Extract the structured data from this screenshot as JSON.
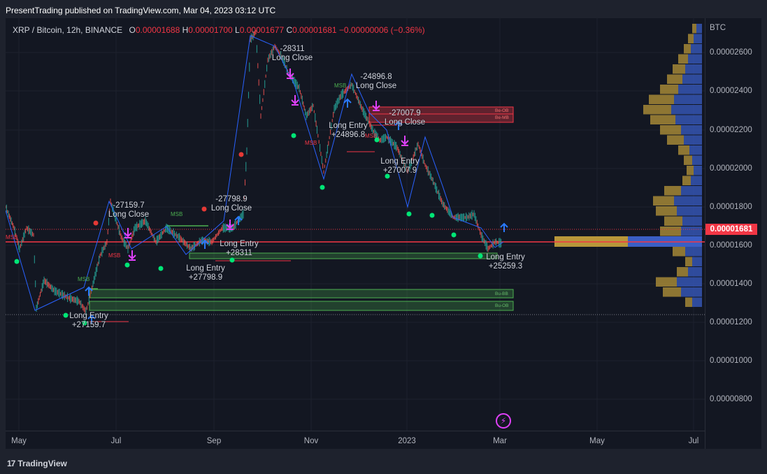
{
  "header": {
    "publisher_text": "PresentTrading published on TradingView.com, Mar 04, 2023 03:12 UTC"
  },
  "legend": {
    "symbol": "XRP / Bitcoin, 12h, BINANCE",
    "open_label": "O",
    "open": "0.00001688",
    "high_label": "H",
    "high": "0.00001700",
    "low_label": "L",
    "low": "0.00001677",
    "close_label": "C",
    "close": "0.00001681",
    "change": "−0.00000006 (−0.36%)"
  },
  "price_axis": {
    "currency": "BTC",
    "labels": [
      "0.00002600",
      "0.00002400",
      "0.00002200",
      "0.00002000",
      "0.00001800",
      "0.00001600",
      "0.00001400",
      "0.00001200",
      "0.00001000",
      "0.00000800"
    ],
    "current_price": "0.00001681"
  },
  "time_axis": {
    "labels": [
      "May",
      "Jul",
      "Sep",
      "Nov",
      "2023",
      "Mar",
      "May",
      "Jul"
    ]
  },
  "annotations": [
    {
      "line1": "-28311",
      "line2": "Long Close"
    },
    {
      "line1": "-24896.8",
      "line2": "Long Close"
    },
    {
      "line1": "-27007.9",
      "line2": "Long Close"
    },
    {
      "line1": "-27159.7",
      "line2": "Long Close"
    },
    {
      "line1": "-27798.9",
      "line2": "Long Close"
    },
    {
      "line1": "Long Entry",
      "line2": "+24896.8"
    },
    {
      "line1": "Long Entry",
      "line2": "+27007.9"
    },
    {
      "line1": "Long Entry",
      "line2": "+28311"
    },
    {
      "line1": "Long Entry",
      "line2": "+27798.9"
    },
    {
      "line1": "Long Entry",
      "line2": "+25259.3"
    },
    {
      "line1": "Long Entry",
      "line2": "+27159.7"
    }
  ],
  "labels": {
    "msb": "MSB",
    "be_ob": "Be-OB",
    "be_mb": "Be-MB",
    "bu_bb": "Bu-BB",
    "bu_ob": "Bu-OB"
  },
  "footer": {
    "brand": "TradingView"
  },
  "colors": {
    "background": "#131722",
    "bull": "#26a69a",
    "bear": "#ef5350",
    "zigzag": "#2962ff",
    "price_line": "#f23645",
    "marker": "#e040fb",
    "entry": "#2979ff",
    "bull_zone": "#4caf50",
    "bear_zone": "#f23645",
    "vp_up": "#3a5ec5",
    "vp_down": "#b8973a"
  },
  "icons": [
    "tradingview-logo-icon",
    "lightning-icon"
  ]
}
